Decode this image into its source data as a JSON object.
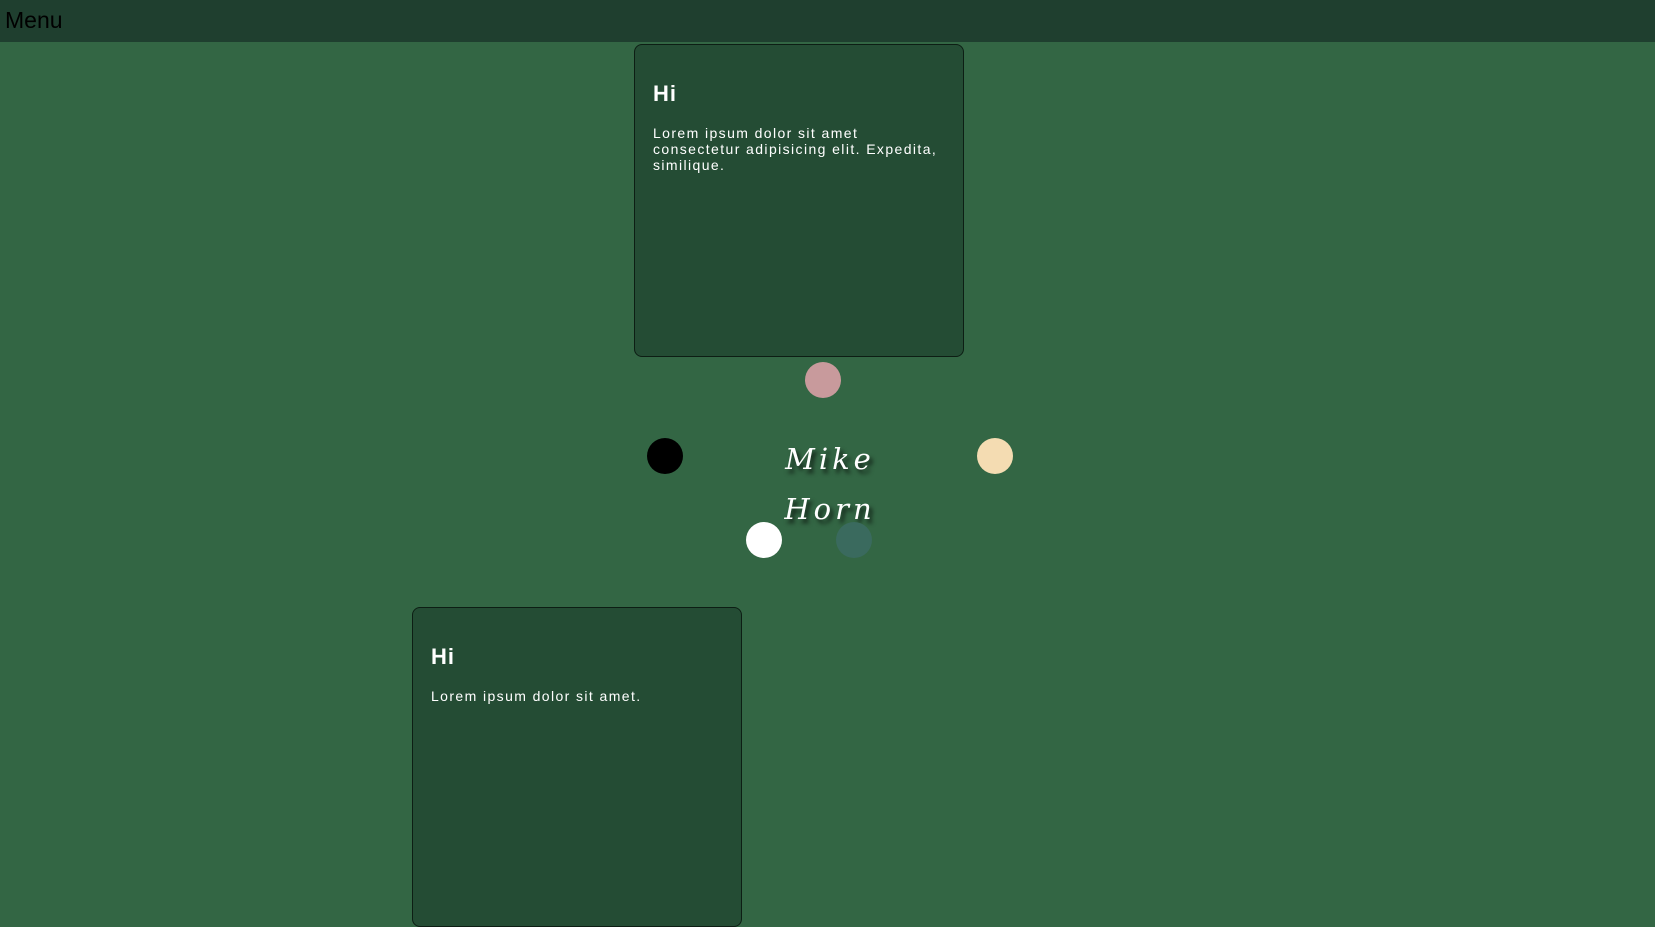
{
  "header": {
    "menu_label": "Menu"
  },
  "cards": [
    {
      "title": "Hi",
      "text": "Lorem ipsum dolor sit amet consectetur adipisicing elit. Expedita, similique."
    },
    {
      "title": "Hi",
      "text": "Lorem ipsum dolor sit amet."
    }
  ],
  "signature": "Mike Horn",
  "dots": {
    "pink": "#c89a9c",
    "black": "#000000",
    "cream": "#f4dcb2",
    "white": "#ffffff",
    "teal": "#3a6a5e"
  },
  "colors": {
    "background": "#336644",
    "topbar": "#1f3f2f",
    "card": "#244c34"
  }
}
